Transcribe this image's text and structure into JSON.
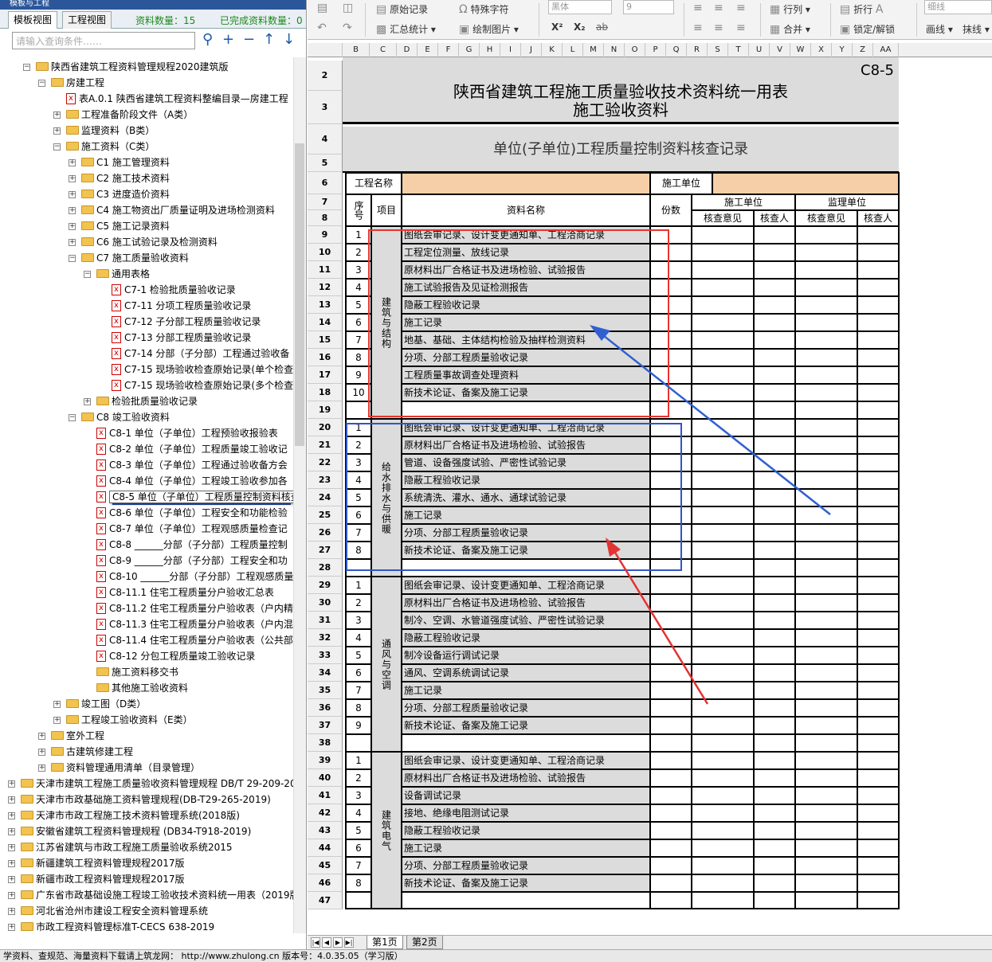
{
  "window_title": "模板与工程",
  "left_tabs": [
    "模板视图",
    "工程视图"
  ],
  "counts": {
    "total_label": "资料数量：15",
    "done_label": "已完成资料数量：0"
  },
  "search": {
    "placeholder": "请输入查询条件……"
  },
  "tree": [
    {
      "label": "陕西省建筑工程资料管理规程2020建筑版",
      "level": 1,
      "type": "folder",
      "exp": "−"
    },
    {
      "label": "房建工程",
      "level": 2,
      "type": "folder",
      "exp": "−"
    },
    {
      "label": "表A.0.1 陕西省建筑工程资料整编目录—房建工程",
      "level": 3,
      "type": "doc",
      "exp": ""
    },
    {
      "label": "工程准备阶段文件（A类）",
      "level": 3,
      "type": "folder",
      "exp": "+"
    },
    {
      "label": "监理资料（B类）",
      "level": 3,
      "type": "folder",
      "exp": "+"
    },
    {
      "label": "施工资料（C类）",
      "level": 3,
      "type": "folder",
      "exp": "−"
    },
    {
      "label": "C1 施工管理资料",
      "level": 4,
      "type": "folder",
      "exp": "+"
    },
    {
      "label": "C2 施工技术资料",
      "level": 4,
      "type": "folder",
      "exp": "+"
    },
    {
      "label": "C3 进度造价资料",
      "level": 4,
      "type": "folder",
      "exp": "+"
    },
    {
      "label": "C4 施工物资出厂质量证明及进场检测资料",
      "level": 4,
      "type": "folder",
      "exp": "+"
    },
    {
      "label": "C5 施工记录资料",
      "level": 4,
      "type": "folder",
      "exp": "+"
    },
    {
      "label": "C6 施工试验记录及检测资料",
      "level": 4,
      "type": "folder",
      "exp": "+"
    },
    {
      "label": "C7 施工质量验收资料",
      "level": 4,
      "type": "folder",
      "exp": "−"
    },
    {
      "label": "通用表格",
      "level": 5,
      "type": "folder",
      "exp": "−"
    },
    {
      "label": "C7-1 检验批质量验收记录",
      "level": 6,
      "type": "doc",
      "exp": ""
    },
    {
      "label": "C7-11 分项工程质量验收记录",
      "level": 6,
      "type": "doc",
      "exp": ""
    },
    {
      "label": "C7-12 子分部工程质量验收记录",
      "level": 6,
      "type": "doc",
      "exp": ""
    },
    {
      "label": "C7-13 分部工程质量验收记录",
      "level": 6,
      "type": "doc",
      "exp": ""
    },
    {
      "label": "C7-14 分部（子分部）工程通过验收备",
      "level": 6,
      "type": "doc",
      "exp": ""
    },
    {
      "label": "C7-15 现场验收检查原始记录(单个检查",
      "level": 6,
      "type": "doc",
      "exp": ""
    },
    {
      "label": "C7-15 现场验收检查原始记录(多个检查",
      "level": 6,
      "type": "doc",
      "exp": ""
    },
    {
      "label": "检验批质量验收记录",
      "level": 5,
      "type": "folder",
      "exp": "+"
    },
    {
      "label": "C8 竣工验收资料",
      "level": 4,
      "type": "folder",
      "exp": "−"
    },
    {
      "label": "C8-1 单位（子单位）工程预验收报验表",
      "level": 5,
      "type": "doc",
      "exp": ""
    },
    {
      "label": "C8-2 单位（子单位）工程质量竣工验收记",
      "level": 5,
      "type": "doc",
      "exp": ""
    },
    {
      "label": "C8-3 单位（子单位）工程通过验收备方会",
      "level": 5,
      "type": "doc",
      "exp": ""
    },
    {
      "label": "C8-4 单位（子单位）工程竣工验收参加各",
      "level": 5,
      "type": "doc",
      "exp": ""
    },
    {
      "label": "C8-5 单位（子单位）工程质量控制资料核查记录",
      "level": 5,
      "type": "doc",
      "exp": "",
      "selected": true
    },
    {
      "label": "C8-6 单位（子单位）工程安全和功能检验",
      "level": 5,
      "type": "doc",
      "exp": ""
    },
    {
      "label": "C8-7 单位（子单位）工程观感质量检查记",
      "level": 5,
      "type": "doc",
      "exp": ""
    },
    {
      "label": "C8-8 ______分部（子分部）工程质量控制",
      "level": 5,
      "type": "doc",
      "exp": ""
    },
    {
      "label": "C8-9 ______分部（子分部）工程安全和功",
      "level": 5,
      "type": "doc",
      "exp": ""
    },
    {
      "label": "C8-10 ______分部（子分部）工程观感质量",
      "level": 5,
      "type": "doc",
      "exp": ""
    },
    {
      "label": "C8-11.1 住宅工程质量分户验收汇总表",
      "level": 5,
      "type": "doc",
      "exp": ""
    },
    {
      "label": "C8-11.2 住宅工程质量分户验收表（户内精",
      "level": 5,
      "type": "doc",
      "exp": ""
    },
    {
      "label": "C8-11.3 住宅工程质量分户验收表（户内混",
      "level": 5,
      "type": "doc",
      "exp": ""
    },
    {
      "label": "C8-11.4 住宅工程质量分户验收表（公共部",
      "level": 5,
      "type": "doc",
      "exp": ""
    },
    {
      "label": "C8-12 分包工程质量竣工验收记录",
      "level": 5,
      "type": "doc",
      "exp": ""
    },
    {
      "label": "施工资料移交书",
      "level": 5,
      "type": "folder",
      "exp": ""
    },
    {
      "label": "其他施工验收资料",
      "level": 5,
      "type": "folder",
      "exp": ""
    },
    {
      "label": "竣工图（D类）",
      "level": 3,
      "type": "folder",
      "exp": "+"
    },
    {
      "label": "工程竣工验收资料（E类）",
      "level": 3,
      "type": "folder",
      "exp": "+"
    },
    {
      "label": "室外工程",
      "level": 2,
      "type": "folder",
      "exp": "+"
    },
    {
      "label": "古建筑修建工程",
      "level": 2,
      "type": "folder",
      "exp": "+"
    },
    {
      "label": "资料管理通用清单（目录管理）",
      "level": 2,
      "type": "folder",
      "exp": "+"
    },
    {
      "label": "天津市建筑工程施工质量验收资料管理规程 DB/T 29-209-20",
      "level": 0,
      "type": "folder",
      "exp": "+"
    },
    {
      "label": "天津市市政基础施工资料管理规程(DB-T29-265-2019)",
      "level": 0,
      "type": "folder",
      "exp": "+"
    },
    {
      "label": "天津市市政工程施工技术资料管理系统(2018版)",
      "level": 0,
      "type": "folder",
      "exp": "+"
    },
    {
      "label": "安徽省建筑工程资料管理规程 (DB34-T918-2019)",
      "level": 0,
      "type": "folder",
      "exp": "+"
    },
    {
      "label": "江苏省建筑与市政工程施工质量验收系统2015",
      "level": 0,
      "type": "folder",
      "exp": "+"
    },
    {
      "label": "新疆建筑工程资料管理规程2017版",
      "level": 0,
      "type": "folder",
      "exp": "+"
    },
    {
      "label": "新疆市政工程资料管理规程2017版",
      "level": 0,
      "type": "folder",
      "exp": "+"
    },
    {
      "label": "广东省市政基础设施工程竣工验收技术资料统一用表（2019版",
      "level": 0,
      "type": "folder",
      "exp": "+"
    },
    {
      "label": "河北省沧州市建设工程安全资料管理系统",
      "level": 0,
      "type": "folder",
      "exp": "+"
    },
    {
      "label": "市政工程资料管理标准T-CECS 638-2019",
      "level": 0,
      "type": "folder",
      "exp": "+"
    }
  ],
  "toolbar": {
    "original_record": "原始记录",
    "special_char": "特殊字符",
    "font_name": "黑体",
    "font_size": "9",
    "row_col": "行列",
    "wrap": "折行",
    "line_thin": "细线",
    "summary": "汇总统计",
    "draw_image": "绘制图片",
    "merge": "合并",
    "lock": "锁定/解锁",
    "draw_line": "画线",
    "erase_line": "抹线"
  },
  "columns": [
    "B",
    "C",
    "D",
    "E",
    "F",
    "G",
    "H",
    "I",
    "J",
    "K",
    "L",
    "M",
    "N",
    "O",
    "P",
    "Q",
    "R",
    "S",
    "T",
    "U",
    "V",
    "W",
    "X",
    "Y",
    "Z",
    "AA"
  ],
  "form": {
    "code": "C8-5",
    "title1": "陕西省建筑工程施工质量验收技术资料统一用表",
    "title2": "施工验收资料",
    "subtitle": "单位(子单位)工程质量控制资料核查记录",
    "project_name_label": "工程名称",
    "contractor_label": "施工单位",
    "hdr_seq": "序号",
    "hdr_item": "项目",
    "hdr_name": "资料名称",
    "hdr_copies": "份数",
    "hdr_contractor": "施工单位",
    "hdr_supervisor": "监理单位",
    "hdr_opinion": "核查意见",
    "hdr_checker": "核查人"
  },
  "sections": [
    {
      "name": "建筑与结构",
      "items": [
        "图纸会审记录、设计变更通知单、工程洽商记录",
        "工程定位测量、放线记录",
        "原材料出厂合格证书及进场检验、试验报告",
        "施工试验报告及见证检测报告",
        "隐蔽工程验收记录",
        "施工记录",
        "地基、基础、主体结构检验及抽样检测资料",
        "分项、分部工程质量验收记录",
        "工程质量事故调查处理资料",
        "新技术论证、备案及施工记录"
      ]
    },
    {
      "name": "给水排水与供暖",
      "items": [
        "图纸会审记录、设计变更通知单、工程洽商记录",
        "原材料出厂合格证书及进场检验、试验报告",
        "管道、设备强度试验、严密性试验记录",
        "隐蔽工程验收记录",
        "系统清洗、灌水、通水、通球试验记录",
        "施工记录",
        "分项、分部工程质量验收记录",
        "新技术论证、备案及施工记录"
      ]
    },
    {
      "name": "通风与空调",
      "items": [
        "图纸会审记录、设计变更通知单、工程洽商记录",
        "原材料出厂合格证书及进场检验、试验报告",
        "制冷、空调、水管道强度试验、严密性试验记录",
        "隐蔽工程验收记录",
        "制冷设备运行调试记录",
        "通风、空调系统调试记录",
        "施工记录",
        "分项、分部工程质量验收记录",
        "新技术论证、备案及施工记录"
      ]
    },
    {
      "name": "建筑电气",
      "items": [
        "图纸会审记录、设计变更通知单、工程洽商记录",
        "原材料出厂合格证书及进场检验、试验报告",
        "设备调试记录",
        "接地、绝缘电阻测试记录",
        "隐蔽工程验收记录",
        "施工记录",
        "分项、分部工程质量验收记录",
        "新技术论证、备案及施工记录"
      ]
    }
  ],
  "sheet_tabs": [
    "第1页",
    "第2页"
  ],
  "status": "学资料、查规范、海量资料下载请上筑龙网： http://www.zhulong.cn  版本号：4.0.35.05（学习版）"
}
